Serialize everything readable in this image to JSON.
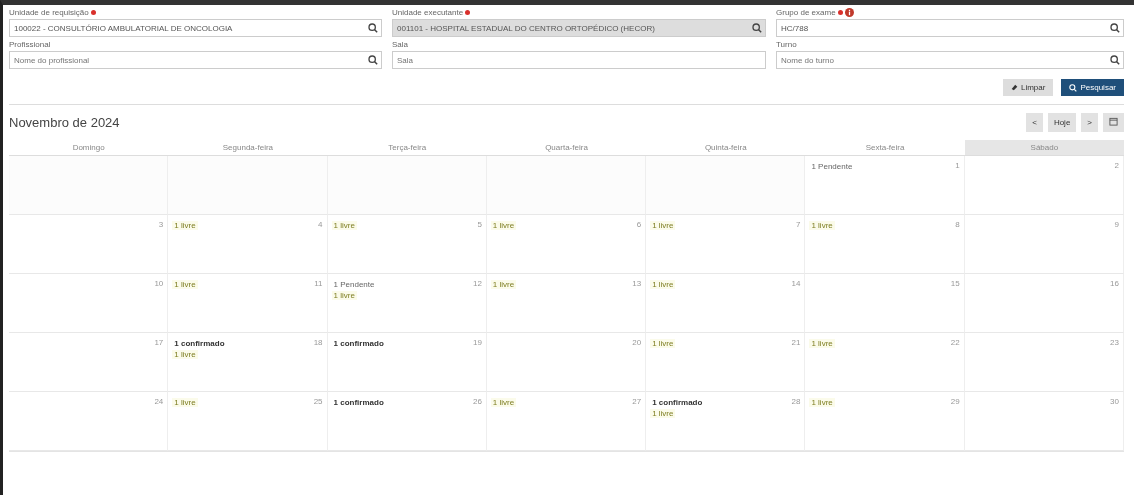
{
  "filters": [
    {
      "label": "Unidade de requisição",
      "required": true,
      "value": "100022 - CONSULTÓRIO AMBULATORIAL DE ONCOLOGIA",
      "disabled": false,
      "search": true
    },
    {
      "label": "Unidade executante",
      "required": true,
      "value": "001101 - HOSPITAL ESTADUAL DO CENTRO ORTOPÉDICO (HECOR)",
      "disabled": true,
      "search": true
    },
    {
      "label": "Grupo de exame",
      "required": true,
      "info": true,
      "value": "HC/788",
      "disabled": false,
      "search": true
    },
    {
      "label": "Profissional",
      "placeholder": "Nome do profissional",
      "disabled": false,
      "search": true
    },
    {
      "label": "Sala",
      "placeholder": "Sala",
      "disabled": false
    },
    {
      "label": "Turno",
      "placeholder": "Nome do turno",
      "disabled": false,
      "search": true
    }
  ],
  "actions": [
    {
      "label": "Limpar",
      "kind": "clear"
    },
    {
      "label": "Pesquisar",
      "kind": "search"
    }
  ],
  "calendar": {
    "title": "Novembro de 2024",
    "nav": {
      "prev": "<",
      "today": "Hoje",
      "next": ">"
    },
    "weekdays": [
      {
        "label": "Domingo",
        "selected": false
      },
      {
        "label": "Segunda-feira",
        "selected": false
      },
      {
        "label": "Terça-feira",
        "selected": false
      },
      {
        "label": "Quarta-feira",
        "selected": false
      },
      {
        "label": "Quinta-feira",
        "selected": false
      },
      {
        "label": "Sexta-feira",
        "selected": false
      },
      {
        "label": "Sábado",
        "selected": true
      }
    ],
    "weeks": [
      [
        {
          "kind": "blank"
        },
        {
          "kind": "blank"
        },
        {
          "kind": "blank"
        },
        {
          "kind": "blank"
        },
        {
          "kind": "blank"
        },
        {
          "kind": "day",
          "day": "1",
          "events": [
            {
              "text": "1 Pendente",
              "kind": "pending"
            }
          ]
        },
        {
          "kind": "day",
          "day": "2"
        }
      ],
      [
        {
          "kind": "day",
          "day": "3"
        },
        {
          "kind": "day",
          "day": "4",
          "events": [
            {
              "text": "1 livre",
              "kind": "free"
            }
          ]
        },
        {
          "kind": "day",
          "day": "5",
          "events": [
            {
              "text": "1 livre",
              "kind": "free"
            }
          ]
        },
        {
          "kind": "day",
          "day": "6",
          "events": [
            {
              "text": "1 livre",
              "kind": "free"
            }
          ]
        },
        {
          "kind": "day",
          "day": "7",
          "events": [
            {
              "text": "1 livre",
              "kind": "free"
            }
          ]
        },
        {
          "kind": "day",
          "day": "8",
          "events": [
            {
              "text": "1 livre",
              "kind": "free"
            }
          ]
        },
        {
          "kind": "day",
          "day": "9"
        }
      ],
      [
        {
          "kind": "day",
          "day": "10"
        },
        {
          "kind": "day",
          "day": "11",
          "events": [
            {
              "text": "1 livre",
              "kind": "free"
            }
          ]
        },
        {
          "kind": "day",
          "day": "12",
          "events": [
            {
              "text": "1 Pendente",
              "kind": "pending"
            },
            {
              "text": "1 livre",
              "kind": "free"
            }
          ]
        },
        {
          "kind": "day",
          "day": "13",
          "events": [
            {
              "text": "1 livre",
              "kind": "free"
            }
          ]
        },
        {
          "kind": "day",
          "day": "14",
          "events": [
            {
              "text": "1 livre",
              "kind": "free"
            }
          ]
        },
        {
          "kind": "day",
          "day": "15"
        },
        {
          "kind": "day",
          "day": "16"
        }
      ],
      [
        {
          "kind": "day",
          "day": "17"
        },
        {
          "kind": "day",
          "day": "18",
          "events": [
            {
              "text": "1 confirmado",
              "kind": "confirmed"
            },
            {
              "text": "1 livre",
              "kind": "free"
            }
          ]
        },
        {
          "kind": "day",
          "day": "19",
          "events": [
            {
              "text": "1 confirmado",
              "kind": "confirmed"
            }
          ]
        },
        {
          "kind": "day",
          "day": "20"
        },
        {
          "kind": "day",
          "day": "21",
          "events": [
            {
              "text": "1 livre",
              "kind": "free"
            }
          ]
        },
        {
          "kind": "day",
          "day": "22",
          "events": [
            {
              "text": "1 livre",
              "kind": "free"
            }
          ]
        },
        {
          "kind": "day",
          "day": "23"
        }
      ],
      [
        {
          "kind": "day",
          "day": "24"
        },
        {
          "kind": "day",
          "day": "25",
          "events": [
            {
              "text": "1 livre",
              "kind": "free"
            }
          ]
        },
        {
          "kind": "day",
          "day": "26",
          "events": [
            {
              "text": "1 confirmado",
              "kind": "confirmed"
            }
          ]
        },
        {
          "kind": "day",
          "day": "27",
          "events": [
            {
              "text": "1 livre",
              "kind": "free"
            }
          ]
        },
        {
          "kind": "day",
          "day": "28",
          "events": [
            {
              "text": "1 confirmado",
              "kind": "confirmed"
            },
            {
              "text": "1 livre",
              "kind": "free"
            }
          ]
        },
        {
          "kind": "day",
          "day": "29",
          "events": [
            {
              "text": "1 livre",
              "kind": "free"
            }
          ]
        },
        {
          "kind": "day",
          "day": "30"
        }
      ]
    ]
  }
}
